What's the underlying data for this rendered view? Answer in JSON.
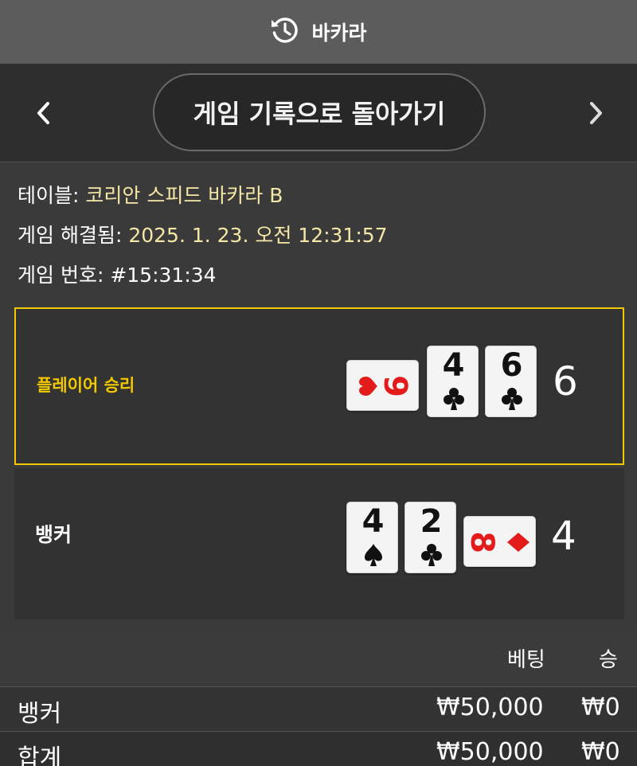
{
  "header": {
    "title": "바카라",
    "icon": "history-icon"
  },
  "nav": {
    "back_label": "게임 기록으로 돌아가기",
    "prev_icon": "chevron-left-icon",
    "next_icon": "chevron-right-icon"
  },
  "info": {
    "table_label": "테이블:",
    "table_value": "코리안 스피드 바카라 B",
    "resolved_label": "게임 해결됨:",
    "resolved_value": "2025. 1. 23. 오전 12:31:57",
    "game_no_label": "게임 번호:",
    "game_no_value": "#15:31:34"
  },
  "player": {
    "label": "플레이어 승리",
    "score": "6",
    "cards": [
      {
        "rank": "9",
        "suit": "heart",
        "orientation": "sideways",
        "color": "red"
      },
      {
        "rank": "4",
        "suit": "club",
        "orientation": "upright",
        "color": "black"
      },
      {
        "rank": "6",
        "suit": "club",
        "orientation": "upright",
        "color": "black"
      }
    ]
  },
  "banker": {
    "label": "뱅커",
    "score": "4",
    "cards": [
      {
        "rank": "4",
        "suit": "spade",
        "orientation": "upright",
        "color": "black"
      },
      {
        "rank": "2",
        "suit": "club",
        "orientation": "upright",
        "color": "black"
      },
      {
        "rank": "8",
        "suit": "diamond",
        "orientation": "sideways",
        "color": "red"
      }
    ]
  },
  "summary": {
    "col_bet": "베팅",
    "col_win": "승",
    "rows": [
      {
        "name": "뱅커",
        "bet": "₩50,000",
        "win": "₩0"
      },
      {
        "name": "합계",
        "bet": "₩50,000",
        "win": "₩0"
      }
    ]
  },
  "colors": {
    "accent_yellow": "#f2c800",
    "info_value": "#f5e7a6",
    "card_red": "#e41b1b"
  }
}
